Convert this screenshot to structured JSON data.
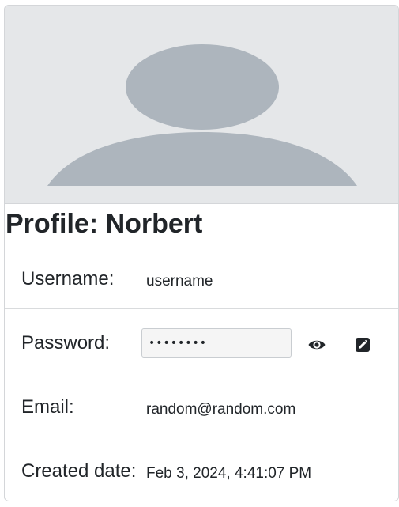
{
  "profile": {
    "title": "Profile: Norbert",
    "avatar_icon": "person-silhouette-icon"
  },
  "fields": {
    "username": {
      "label": "Username:",
      "value": "username"
    },
    "password": {
      "label": "Password:",
      "value": "••••••••",
      "reveal_icon": "eye-icon",
      "edit_icon": "pencil-square-icon"
    },
    "email": {
      "label": "Email:",
      "value": "random@random.com"
    },
    "created": {
      "label": "Created date:",
      "value": "Feb 3, 2024, 4:41:07 PM"
    }
  },
  "colors": {
    "avatar_background": "#e5e7e9",
    "avatar_silhouette": "#adb5bd",
    "text": "#212529",
    "border": "#d4d6d9"
  }
}
